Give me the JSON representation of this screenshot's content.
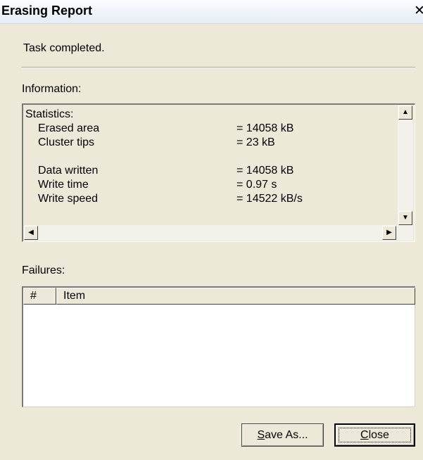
{
  "window": {
    "title": "Erasing Report",
    "close_glyph": "✕"
  },
  "status": {
    "text": "Task completed."
  },
  "information": {
    "label": "Information:",
    "heading": "Statistics:",
    "stats": [
      {
        "name": "Erased area",
        "value": "= 14058 kB"
      },
      {
        "name": "Cluster tips",
        "value": "= 23 kB"
      },
      {
        "name": "Data written",
        "value": "= 14058 kB"
      },
      {
        "name": "Write time",
        "value": "= 0.97 s"
      },
      {
        "name": "Write speed",
        "value": "= 14522 kB/s"
      }
    ]
  },
  "failures": {
    "label": "Failures:",
    "columns": [
      "#",
      "Item"
    ],
    "rows": []
  },
  "buttons": {
    "save_as": {
      "mnemonic": "S",
      "rest": "ave As..."
    },
    "close": {
      "mnemonic": "C",
      "rest": "lose"
    }
  },
  "icons": {
    "close": "close-icon",
    "scroll_up": "arrow-up-icon",
    "scroll_down": "arrow-down-icon",
    "scroll_left": "arrow-left-icon",
    "scroll_right": "arrow-right-icon"
  }
}
